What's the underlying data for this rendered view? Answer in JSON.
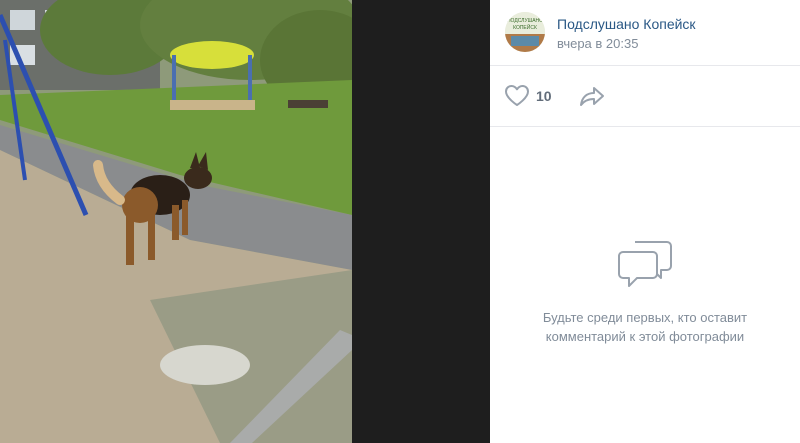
{
  "post": {
    "author": "Подслушано Копейск",
    "time": "вчера в 20:35",
    "likes": "10"
  },
  "avatar": {
    "text_line1": "ПОДСЛУШАНО",
    "text_line2": "КОПЕЙСК"
  },
  "comments": {
    "empty_text": "Будьте среди первых, кто оставит комментарий к этой фотографии"
  },
  "icons": {
    "like": "heart-icon",
    "share": "share-arrow-icon",
    "empty": "comments-bubble-icon"
  },
  "colors": {
    "link": "#2a5885",
    "muted": "#818c99",
    "divider": "#e7e8ec",
    "icon": "#99a2ad"
  }
}
